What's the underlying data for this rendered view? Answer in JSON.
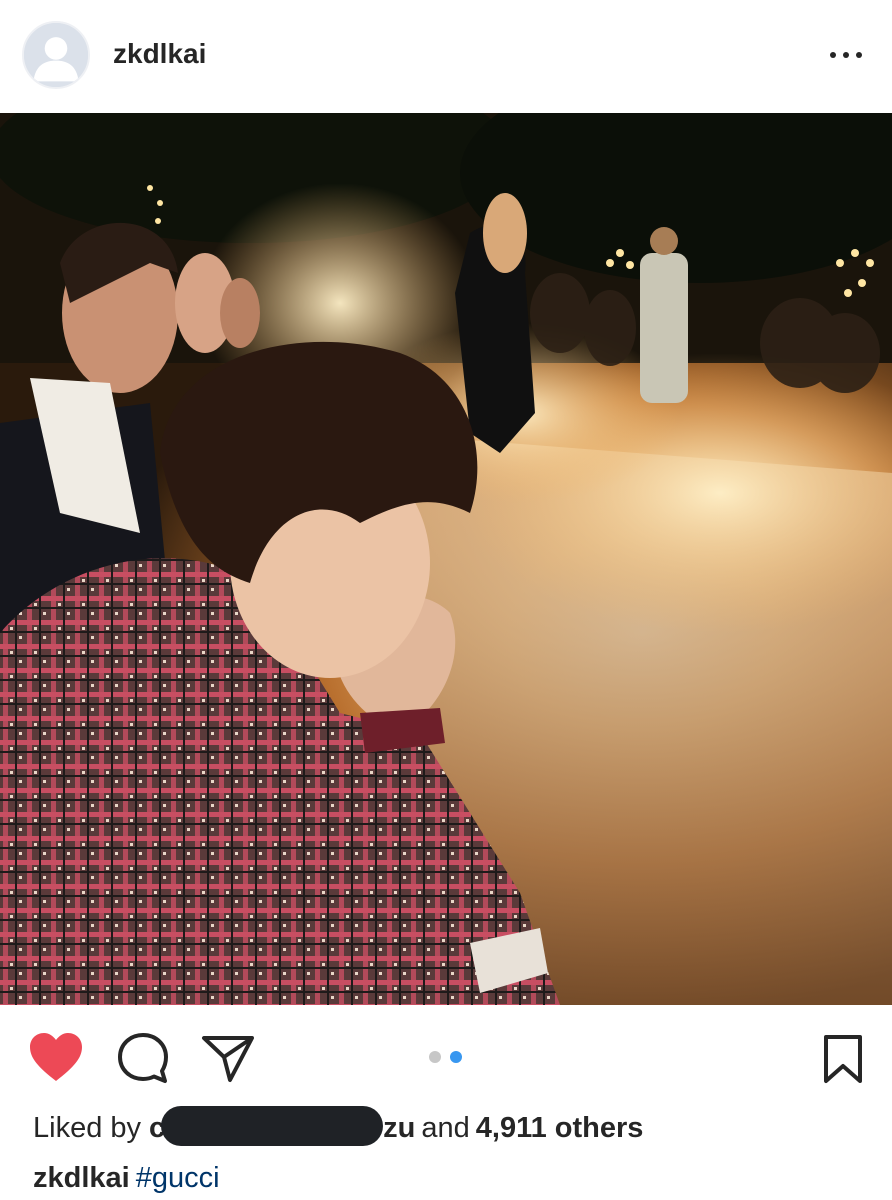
{
  "post": {
    "username": "zkdlkai",
    "photo_description_icon": "post-photo",
    "carousel": {
      "total": 2,
      "active_index": 1
    }
  },
  "likes": {
    "prefix": "Liked by",
    "name_start": "c",
    "name_end": "zu",
    "conjunction": "and",
    "count_text": "4,911 others"
  },
  "caption": {
    "username": "zkdlkai",
    "hashtag": "#gucci"
  },
  "icons": {
    "more": "more-options-icon",
    "like": "heart-icon",
    "comment": "comment-icon",
    "share": "direct-share-icon",
    "save": "bookmark-icon"
  },
  "colors": {
    "heart": "#ed4956",
    "hashtag": "#003569",
    "active_dot": "#3897f0",
    "inactive_dot": "#c7c7c7",
    "text": "#262626"
  }
}
